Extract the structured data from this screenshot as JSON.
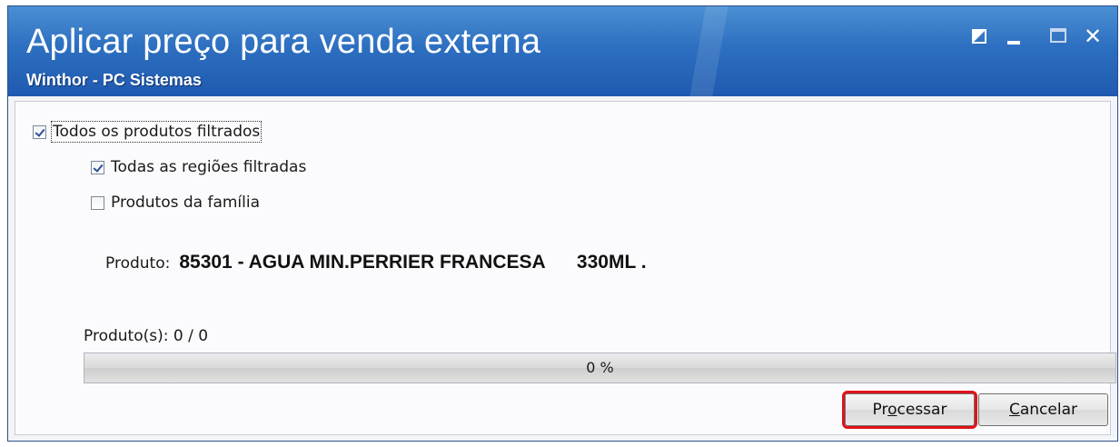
{
  "window": {
    "title": "Aplicar preço para venda externa",
    "subtitle": "Winthor - PC Sistemas",
    "controls": [
      "restore-icon",
      "minimize-icon",
      "maximize-icon",
      "close-icon"
    ],
    "close_glyph": "✕"
  },
  "options": {
    "todos_produtos": {
      "label": "Todos os produtos filtrados",
      "checked": true
    },
    "todas_regioes": {
      "label": "Todas as regiões filtradas",
      "checked": true
    },
    "produtos_familia": {
      "label": "Produtos da família",
      "checked": false
    }
  },
  "produto": {
    "label": "Produto:",
    "value": "85301 - AGUA MIN.PERRIER FRANCESA      330ML ."
  },
  "progress": {
    "count_label": "Produto(s): 0 / 0",
    "percent_text": "0 %",
    "value": 0
  },
  "buttons": {
    "processar": {
      "pre": "Pr",
      "accel": "o",
      "post": "cessar"
    },
    "cancelar": {
      "pre": "",
      "accel": "C",
      "post": "ancelar"
    }
  },
  "colors": {
    "title_bar": "#2d6fc0",
    "highlight": "#e01218",
    "progress_fill": "#3fae3f"
  }
}
